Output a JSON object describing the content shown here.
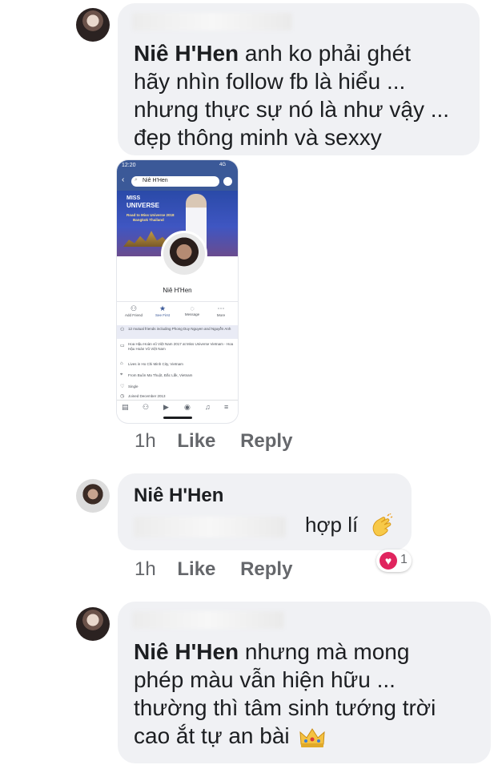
{
  "comments": [
    {
      "author": "Niê H'Hen",
      "text_lines": [
        "anh ko phải ghét",
        "hãy nhìn follow fb là hiểu ...",
        "nhưng thực sự nó là như vậy ...",
        "đẹp thông minh và sexxy"
      ]
    },
    {
      "time": "1h",
      "like": "Like",
      "reply": "Reply"
    },
    {
      "author": "Niê H'Hen",
      "text": "hợp lí",
      "emoji": "clapping-hands",
      "time": "1h",
      "like": "Like",
      "reply": "Reply",
      "reaction_count": "1"
    },
    {
      "author": "Niê H'Hen",
      "text_lines": [
        "nhưng mà mong",
        "phép màu vẫn hiện hữu ...",
        "thường thì tâm sinh tướng trời",
        "cao ắt tự an bài"
      ],
      "emoji": "crown"
    }
  ],
  "phone_screenshot": {
    "status_time": "12:20",
    "status_right": "4G",
    "search_text": "Niê H'Hen",
    "cover_title_1": "MISS",
    "cover_title_2": "UNIVERSE",
    "cover_sub_1": "Road to Miss Universe 2018",
    "cover_sub_2": "Bangkok Thailand",
    "profile_name": "Niê H'Hen",
    "actions": [
      "Add Friend",
      "See First",
      "Message",
      "More"
    ],
    "info": [
      "12 mutual friends including Phong Duy Nguyen and Nguyễn Anh",
      "Hoa Hậu Hoàn vũ Việt Nam 2017 at Miss Universe Vietnam - Hoa Hậu Hoàn Vũ Việt Nam",
      "Lives in Ho Chi Minh City, Vietnam",
      "From Buôn Ma Thuột, Đắc Lắk, Vietnam",
      "Single",
      "Joined December 2013"
    ]
  },
  "colors": {
    "bubble": "#f0f1f4",
    "text": "#1c1e21",
    "meta": "#65676b",
    "fb_blue": "#3b5998",
    "heart": "#e0245e"
  }
}
